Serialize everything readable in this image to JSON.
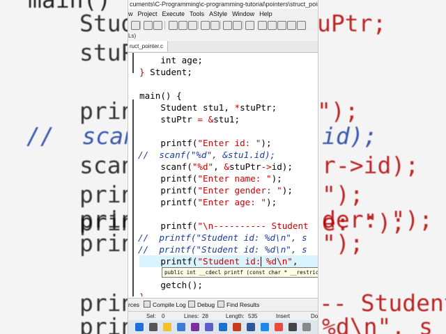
{
  "background_code": {
    "lines": [
      {
        "text": "main()",
        "kind": "kw"
      },
      {
        "text": "Stud",
        "kind": "fg",
        "tail": "uPtr;"
      },
      {
        "text": "stuP",
        "kind": "fg"
      },
      {
        "text": "printf",
        "kind": "fg",
        "tail": "\");"
      },
      {
        "text": "//  scanf",
        "kind": "cmt",
        "tail": "id);"
      },
      {
        "text": "scanf",
        "kind": "fg",
        "tail": "r->id);"
      },
      {
        "text": "printf",
        "kind": "fg",
        "tail": "\");"
      },
      {
        "text": "printf",
        "kind": "fg",
        "tail": "e: \");"
      },
      {
        "text": "prin",
        "kind": "fg",
        "tail": "der: \");"
      },
      {
        "text": "prin",
        "kind": "fg",
        "tail": "\");"
      },
      {
        "text": "print",
        "kind": "fg",
        "tail": "-- Student"
      },
      {
        "text": "print",
        "kind": "fg",
        "tail": "%d\\n\", s"
      }
    ]
  },
  "window": {
    "title": "cuments\\C-Programming\\c-programming-tutorial\\pointers\\struct_pointer.c - Dev",
    "menu": [
      "w",
      "Project",
      "Execute",
      "Tools",
      "AStyle",
      "Window",
      "Help"
    ],
    "subbar_label": "Ls)",
    "tab_label": "ruct_pointer.c"
  },
  "editor": {
    "lines": [
      {
        "text": "    int age;",
        "type": "code"
      },
      {
        "text": "} Student;",
        "type": "close"
      },
      {
        "text": "",
        "type": "blank"
      },
      {
        "text": "main() {",
        "type": "code"
      },
      {
        "text": "    Student stu1, *stuPtr;",
        "type": "code"
      },
      {
        "text": "    stuPtr = &stu1;",
        "type": "code"
      },
      {
        "text": "",
        "type": "blank"
      },
      {
        "text": "    printf(\"Enter id: \");",
        "type": "code"
      },
      {
        "text": "//  scanf(\"%d\", &stu1.id);",
        "type": "comment"
      },
      {
        "text": "    scanf(\"%d\", &stuPtr->id);",
        "type": "code"
      },
      {
        "text": "    printf(\"Enter name: \");",
        "type": "code"
      },
      {
        "text": "    printf(\"Enter gender: \");",
        "type": "code"
      },
      {
        "text": "    printf(\"Enter age: \");",
        "type": "code"
      },
      {
        "text": "",
        "type": "blank"
      },
      {
        "text": "    printf(\"\\n---------- Student",
        "type": "code"
      },
      {
        "text": "//  printf(\"Student id: %d\\n\", s",
        "type": "comment"
      },
      {
        "text": "//  printf(\"Student id: %d\\n\", s",
        "type": "comment"
      },
      {
        "text": "    printf(\"Student id: %d\\n\", ",
        "type": "current"
      },
      {
        "text": "",
        "type": "blank"
      },
      {
        "text": "    getch();",
        "type": "code"
      },
      {
        "text": "}",
        "type": "close"
      }
    ],
    "tooltip": "public int __cdecl printf (const char * __restrict"
  },
  "bottom_tabs": [
    "rces",
    "Compile Log",
    "Debug",
    "Find Results"
  ],
  "status": {
    "sel_label": "Sel:",
    "sel_value": "0",
    "lines_label": "Lines:",
    "lines_value": "28",
    "length_label": "Length:",
    "length_value": "535",
    "mode": "Insert",
    "extra": "Do"
  },
  "taskbar_icons": [
    "windows-icon",
    "search-icon",
    "file-explorer-icon",
    "photos-icon",
    "onenote-icon",
    "teams-icon",
    "outlook-icon",
    "powerpoint-icon",
    "word-icon",
    "edge-icon",
    "chrome-icon",
    "devcpp-icon",
    "app-icon"
  ],
  "colors": {
    "string": "#cc0000",
    "comment": "#1a3c9c",
    "current_line": "#d9f3ff"
  }
}
